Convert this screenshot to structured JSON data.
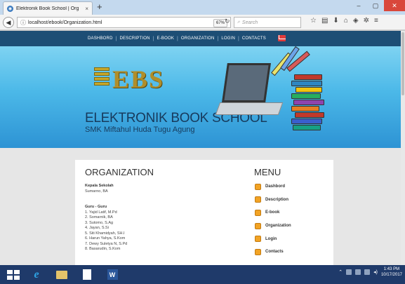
{
  "browser": {
    "tab_title": "Elektronik Book School | Org",
    "tab_close": "×",
    "new_tab": "+",
    "url": "localhost/ebook/Organization.html",
    "zoom": "67%",
    "search_placeholder": "Search"
  },
  "window": {
    "minimize": "–",
    "maximize": "▢",
    "close": "✕"
  },
  "site": {
    "nav": [
      "DASHBORD",
      "DESCRIPTION",
      "E-BOOK",
      "ORGANIZATION",
      "LOGIN",
      "CONTACTS"
    ],
    "logo": "EBS",
    "school_name": "ELEKTRONIK BOOK SCHOOL",
    "school_sub": "SMK Miftahul Huda Tugu Agung"
  },
  "content": {
    "title": "ORGANIZATION",
    "head_label": "Kepala Sekolah",
    "head_name": "Sumarno, BA",
    "teachers_label": "Guru - Guru",
    "teachers": [
      "1. Yajid Latif, M.Pd",
      "2. Somarnik, BA",
      "3. Sutomo, S.Ag",
      "4. Jayan, S.Si",
      "5. Siti Khamidyah, SH.I",
      "6. Harun Yahya, S.Kom",
      "7. Dewy Suletya N, S.Pd",
      "8. Basarudin, S.Kom"
    ]
  },
  "menu": {
    "title": "MENU",
    "items": [
      "Dashbord",
      "Description",
      "E-book",
      "Organization",
      "Login",
      "Contacts"
    ]
  },
  "taskbar": {
    "time": "1:43 PM",
    "date": "10/17/2017"
  },
  "colors": {
    "nav_bg": "#1d4e75",
    "menu_bullet": "#f2a324",
    "taskbar": "#1f3a6a",
    "close_btn": "#d9473b"
  }
}
